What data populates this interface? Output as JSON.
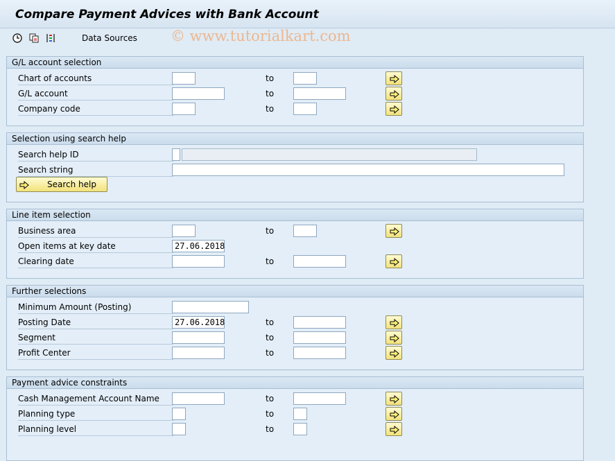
{
  "window": {
    "title": "Compare Payment Advices with Bank Account",
    "watermark": "© www.tutorialkart.com"
  },
  "toolbar": {
    "icons": [
      "execute-icon",
      "copy-icon",
      "variant-icon"
    ],
    "data_sources_label": "Data Sources"
  },
  "groups": {
    "gl": {
      "title": "G/L account selection",
      "rows": [
        {
          "label": "Chart of accounts",
          "to": "to",
          "low": "",
          "high": ""
        },
        {
          "label": "G/L account",
          "to": "to",
          "low": "",
          "high": ""
        },
        {
          "label": "Company code",
          "to": "to",
          "low": "",
          "high": ""
        }
      ]
    },
    "search": {
      "title": "Selection using search help",
      "rows": [
        {
          "label": "Search help ID",
          "value": "",
          "desc": ""
        },
        {
          "label": "Search string",
          "value": ""
        }
      ],
      "button_label": "Search help"
    },
    "lineitem": {
      "title": "Line item selection",
      "rows": [
        {
          "label": "Business area",
          "to": "to",
          "low": "",
          "high": ""
        },
        {
          "label": "Open items at key date",
          "low": "27.06.2018"
        },
        {
          "label": "Clearing date",
          "to": "to",
          "low": "",
          "high": ""
        }
      ]
    },
    "further": {
      "title": "Further selections",
      "rows": [
        {
          "label": "Minimum Amount (Posting)",
          "low": ""
        },
        {
          "label": "Posting Date",
          "to": "to",
          "low": "27.06.2018",
          "high": ""
        },
        {
          "label": "Segment",
          "to": "to",
          "low": "",
          "high": ""
        },
        {
          "label": "Profit Center",
          "to": "to",
          "low": "",
          "high": ""
        }
      ]
    },
    "advice": {
      "title": "Payment advice constraints",
      "rows": [
        {
          "label": "Cash Management Account Name",
          "to": "to",
          "low": "",
          "high": ""
        },
        {
          "label": "Planning type",
          "to": "to",
          "low": "",
          "high": ""
        },
        {
          "label": "Planning level",
          "to": "to",
          "low": "",
          "high": ""
        }
      ]
    }
  },
  "colors": {
    "background": "#dfebf5",
    "button_yellow": "#f2e27a",
    "group_border": "#a8bed3"
  }
}
